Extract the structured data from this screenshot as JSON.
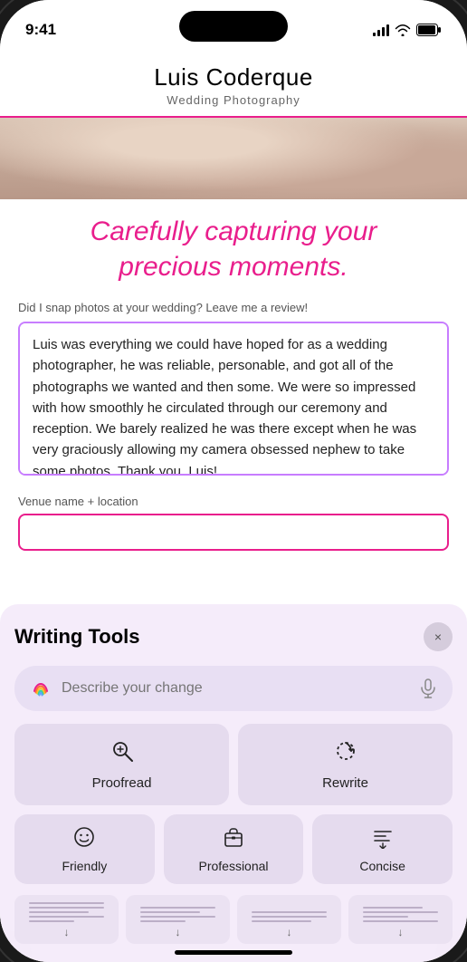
{
  "status_bar": {
    "time": "9:41"
  },
  "site": {
    "title": "Luis Coderque",
    "subtitle": "Wedding Photography"
  },
  "hero": {
    "heading": "Carefully capturing your precious moments."
  },
  "review": {
    "label": "Did I snap photos at your wedding? Leave me a review!",
    "text": "Luis was everything we could have hoped for as a wedding photographer, he was reliable, personable, and got all of the photographs we wanted and then some. We were so impressed with how smoothly he circulated through our ceremony and reception. We barely realized he was there except when he was very graciously allowing my camera obsessed nephew to take some photos. Thank you, Luis!",
    "venue_label": "Venue name + location",
    "venue_placeholder": ""
  },
  "writing_tools": {
    "title": "Writing Tools",
    "describe_placeholder": "Describe your change",
    "close_label": "×",
    "proofread_label": "Proofread",
    "rewrite_label": "Rewrite",
    "friendly_label": "Friendly",
    "professional_label": "Professional",
    "concise_label": "Concise"
  }
}
